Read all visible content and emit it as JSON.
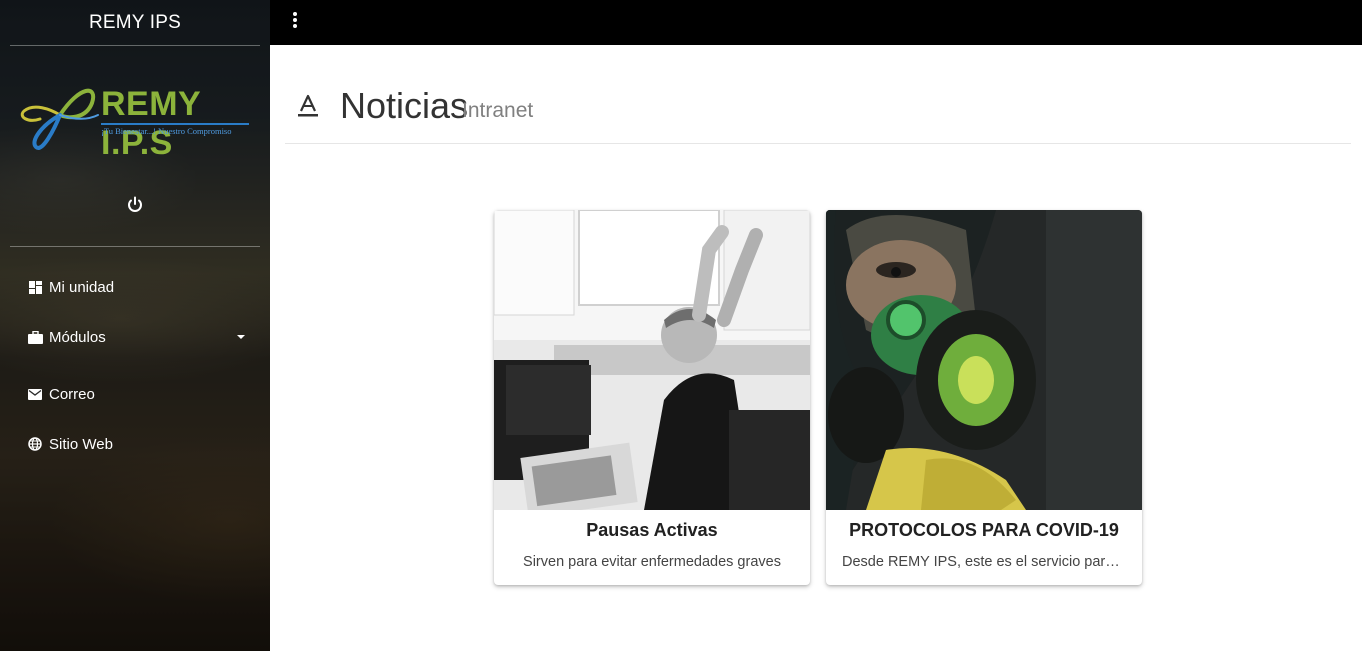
{
  "sidebar": {
    "brand": "REMY IPS",
    "logo": {
      "name": "REMY I.P.S",
      "tagline": "¡Tu Bienestar...! Nuestro Compromiso"
    },
    "power_icon": "power-icon",
    "items": [
      {
        "label": "Mi unidad",
        "icon": "dashboard-icon"
      },
      {
        "label": "Módulos",
        "icon": "briefcase-icon",
        "has_dropdown": true
      },
      {
        "label": "Correo",
        "icon": "mail-icon"
      },
      {
        "label": "Sitio Web",
        "icon": "globe-icon"
      }
    ]
  },
  "topbar": {
    "menu_icon": "more-vert-icon"
  },
  "header": {
    "icon": "text-format-icon",
    "title": "Noticias",
    "subtitle": "Intranet"
  },
  "cards": [
    {
      "title": "Pausas Activas",
      "description": "Sirven para evitar enfermedades graves"
    },
    {
      "title": "PROTOCOLOS PARA COVID-19",
      "description": "Desde REMY IPS, este es el servicio para pr..."
    }
  ],
  "colors": {
    "topbar": "#000000",
    "logo_green": "#8cb33b",
    "logo_blue": "#2a7cc7"
  }
}
